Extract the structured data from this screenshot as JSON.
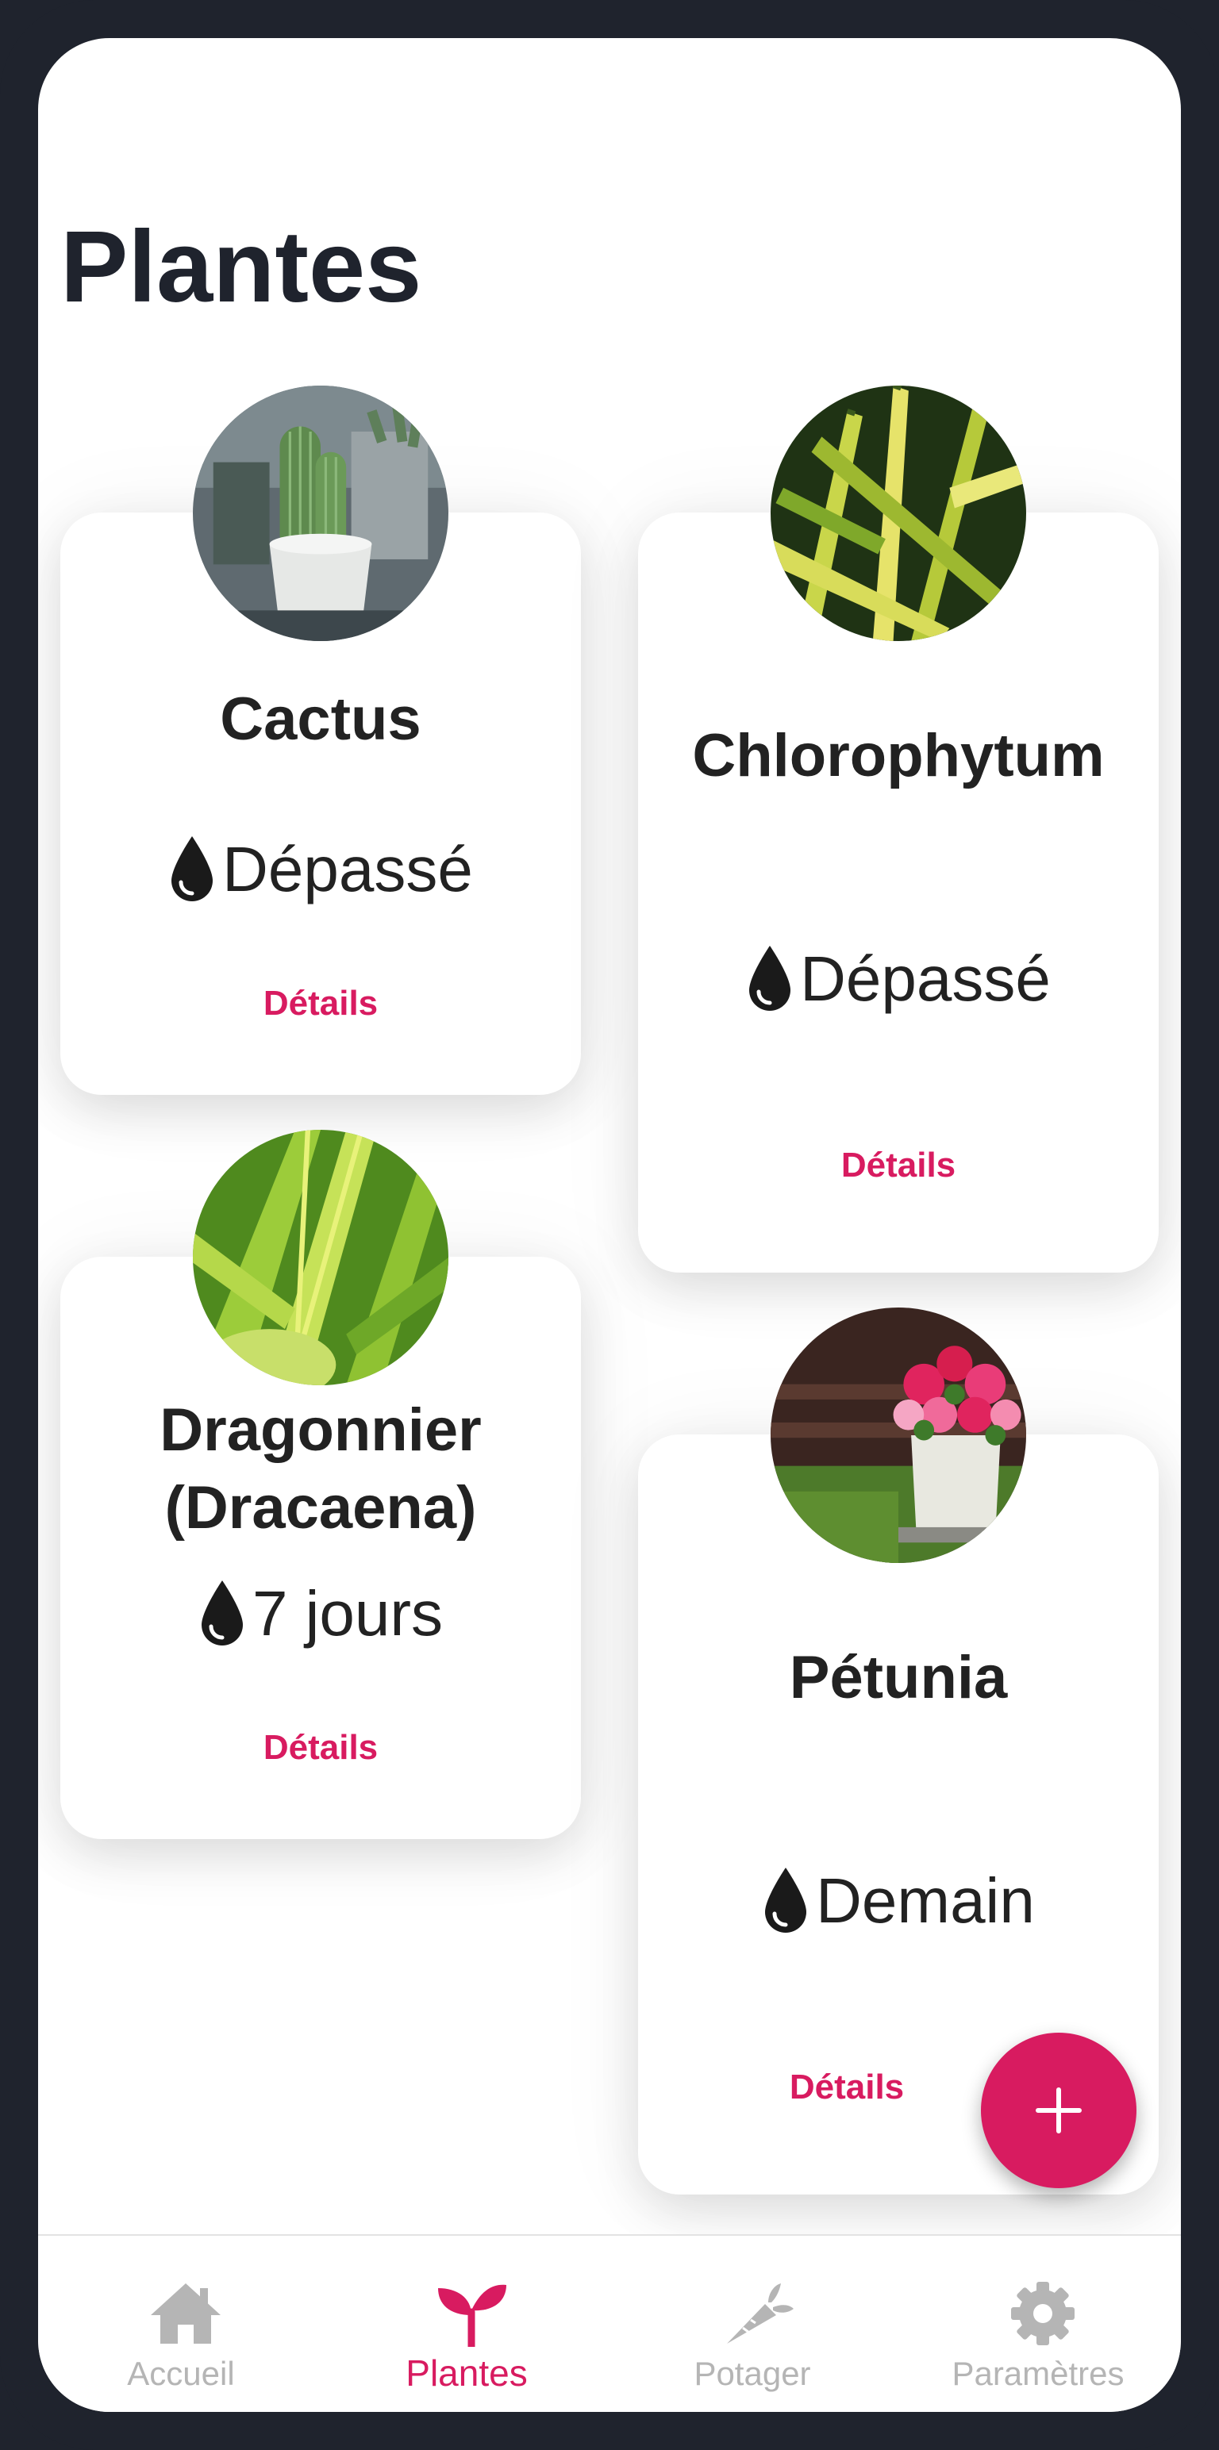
{
  "page": {
    "title": "Plantes"
  },
  "plants": [
    {
      "name": "Cactus",
      "water": "Dépassé",
      "details_label": "Détails"
    },
    {
      "name": "Chlorophytum",
      "water": "Dépassé",
      "details_label": "Détails"
    },
    {
      "name": "Dragonnier\n(Dracaena)",
      "water": "7 jours",
      "details_label": "Détails"
    },
    {
      "name": "Pétunia",
      "water": "Demain",
      "details_label": "Détails"
    }
  ],
  "fab": {
    "icon": "plus-icon"
  },
  "nav": {
    "items": [
      {
        "label": "Accueil",
        "icon": "home-icon",
        "active": false
      },
      {
        "label": "Plantes",
        "icon": "sprout-icon",
        "active": true
      },
      {
        "label": "Potager",
        "icon": "carrot-icon",
        "active": false
      },
      {
        "label": "Paramètres",
        "icon": "gear-icon",
        "active": false
      }
    ]
  },
  "colors": {
    "accent": "#d81b60",
    "frame": "#1f232d",
    "text": "#222222",
    "nav_inactive": "#b5b5b5"
  }
}
